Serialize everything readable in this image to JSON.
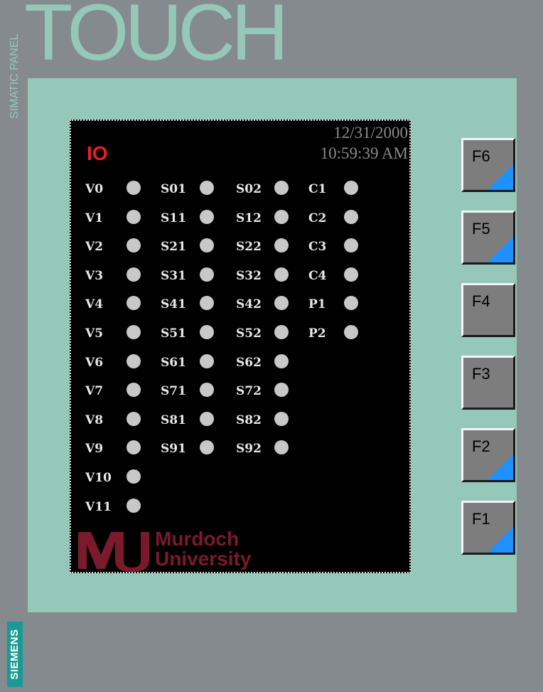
{
  "panel": {
    "product_line": "SIMATIC PANEL",
    "model": "TOUCH",
    "brand": "SIEMENS"
  },
  "screen": {
    "title": "IO",
    "date": "12/31/2000",
    "time": "10:59:39 AM",
    "logo": {
      "mark": "MU",
      "line1": "Murdoch",
      "line2": "University"
    }
  },
  "io_columns": [
    {
      "labels": [
        "V0",
        "V1",
        "V2",
        "V3",
        "V4",
        "V5",
        "V6",
        "V7",
        "V8",
        "V9",
        "V10",
        "V11"
      ]
    },
    {
      "labels": [
        "S01",
        "S11",
        "S21",
        "S31",
        "S41",
        "S51",
        "S61",
        "S71",
        "S81",
        "S91"
      ]
    },
    {
      "labels": [
        "S02",
        "S12",
        "S22",
        "S32",
        "S42",
        "S52",
        "S62",
        "S72",
        "S82",
        "S92"
      ]
    },
    {
      "labels": [
        "C1",
        "C2",
        "C3",
        "C4",
        "P1",
        "P2"
      ]
    }
  ],
  "function_keys": [
    {
      "label": "F6",
      "has_indicator": true
    },
    {
      "label": "F5",
      "has_indicator": true
    },
    {
      "label": "F4",
      "has_indicator": false
    },
    {
      "label": "F3",
      "has_indicator": false
    },
    {
      "label": "F2",
      "has_indicator": true
    },
    {
      "label": "F1",
      "has_indicator": true
    }
  ],
  "colors": {
    "bezel": "#96c8ba",
    "housing": "#848a8e",
    "title_red": "#ee1c24",
    "lamp_off": "#c8c8c8",
    "key_indicator": "#1e90ff",
    "logo": "#7a1a2c"
  }
}
